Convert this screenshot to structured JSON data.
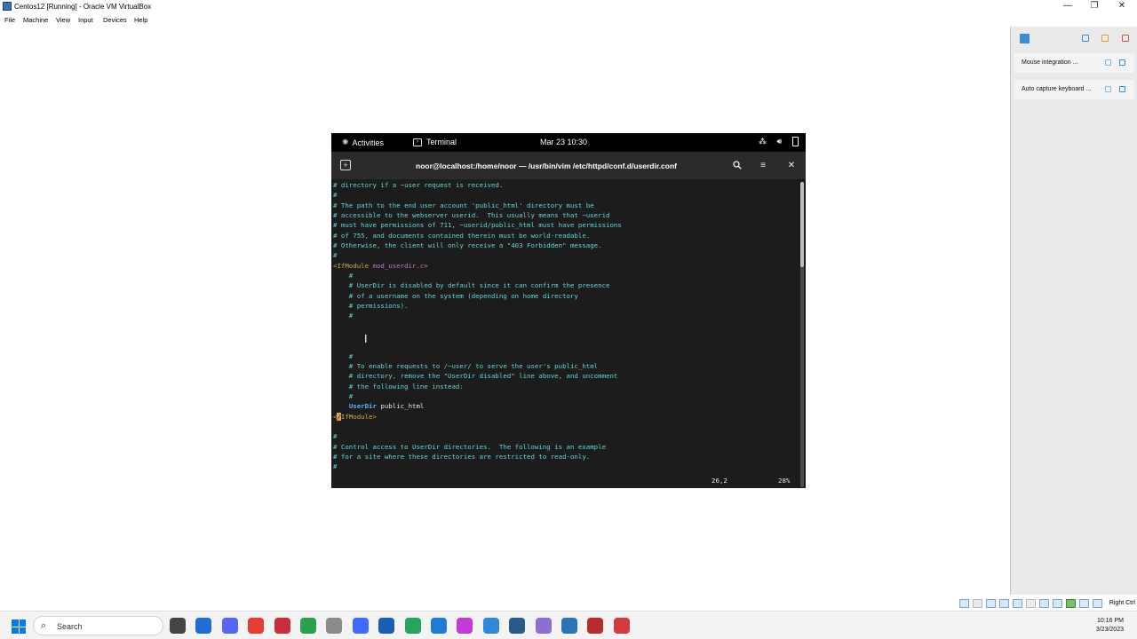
{
  "window": {
    "title": "Centos12 [Running] - Oracle VM VirtualBox",
    "controls": {
      "minimize": "—",
      "restore": "❐",
      "close": "✕"
    }
  },
  "menubar": {
    "items": [
      "File",
      "Machine",
      "View",
      "Input",
      "Devices",
      "Help"
    ]
  },
  "gnome": {
    "activities": "Activities",
    "app": "Terminal",
    "clock": "Mar 23  10:30"
  },
  "terminal": {
    "title": "noor@localhost:/home/noor — /usr/bin/vim /etc/httpd/conf.d/userdir.conf",
    "new_tab": "+",
    "menu": "≡",
    "close": "✕"
  },
  "vim": {
    "lines": [
      "# directory if a ~user request is received.",
      "#",
      "# The path to the end user account 'public_html' directory must be",
      "# accessible to the webserver userid.  This usually means that ~userid",
      "# must have permissions of 711, ~userid/public_html must have permissions",
      "# of 755, and documents contained therein must be world-readable.",
      "# Otherwise, the client will only receive a \"403 Forbidden\" message.",
      "#",
      "<IfModule mod_userdir.c>",
      "    #",
      "    # UserDir is disabled by default since it can confirm the presence",
      "    # of a username on the system (depending on home directory",
      "    # permissions).",
      "    #",
      "",
      "",
      "    #",
      "    # To enable requests to /~user/ to serve the user's public_html",
      "    # directory, remove the \"UserDir disabled\" line above, and uncomment",
      "    # the following line instead:",
      "    #",
      "    UserDir public_html",
      "</IfModule>",
      "",
      "#",
      "# Control access to UserDir directories.  The following is an example",
      "# for a site where these directories are restricted to read-only.",
      "#"
    ],
    "ifmodule_open": {
      "lt": "<",
      "tag": "IfModule",
      "mod": "mod_userdir.c",
      "gt": ">"
    },
    "ifmodule_close": {
      "lt": "<",
      "cursor_char": "/",
      "tag": "IfModule",
      "gt": ">"
    },
    "userdir": {
      "keyword": "UserDir",
      "value": "public_html"
    },
    "position": "26,2",
    "percent": "28%",
    "scroll_fraction": 0.28
  },
  "notifications": [
    {
      "text": "Mouse integration ..."
    },
    {
      "text": "Auto capture keyboard ..."
    }
  ],
  "statusbar": {
    "host_key": "Right Ctrl"
  },
  "taskbar": {
    "search": "Search",
    "time": "10:16 PM",
    "date": "3/23/2023",
    "app_colors": [
      "#444444",
      "#1f6fd1",
      "#5865f2",
      "#e33e2f",
      "#c72d3a",
      "#2aa14d",
      "#8a8a8a",
      "#3b6cff",
      "#1a5fb4",
      "#26a55e",
      "#1f7bd6",
      "#c33cd8",
      "#2c8ad6",
      "#2a5a8a",
      "#8c6fd0",
      "#2d73b9",
      "#b52c2c",
      "#d23c3c"
    ]
  }
}
